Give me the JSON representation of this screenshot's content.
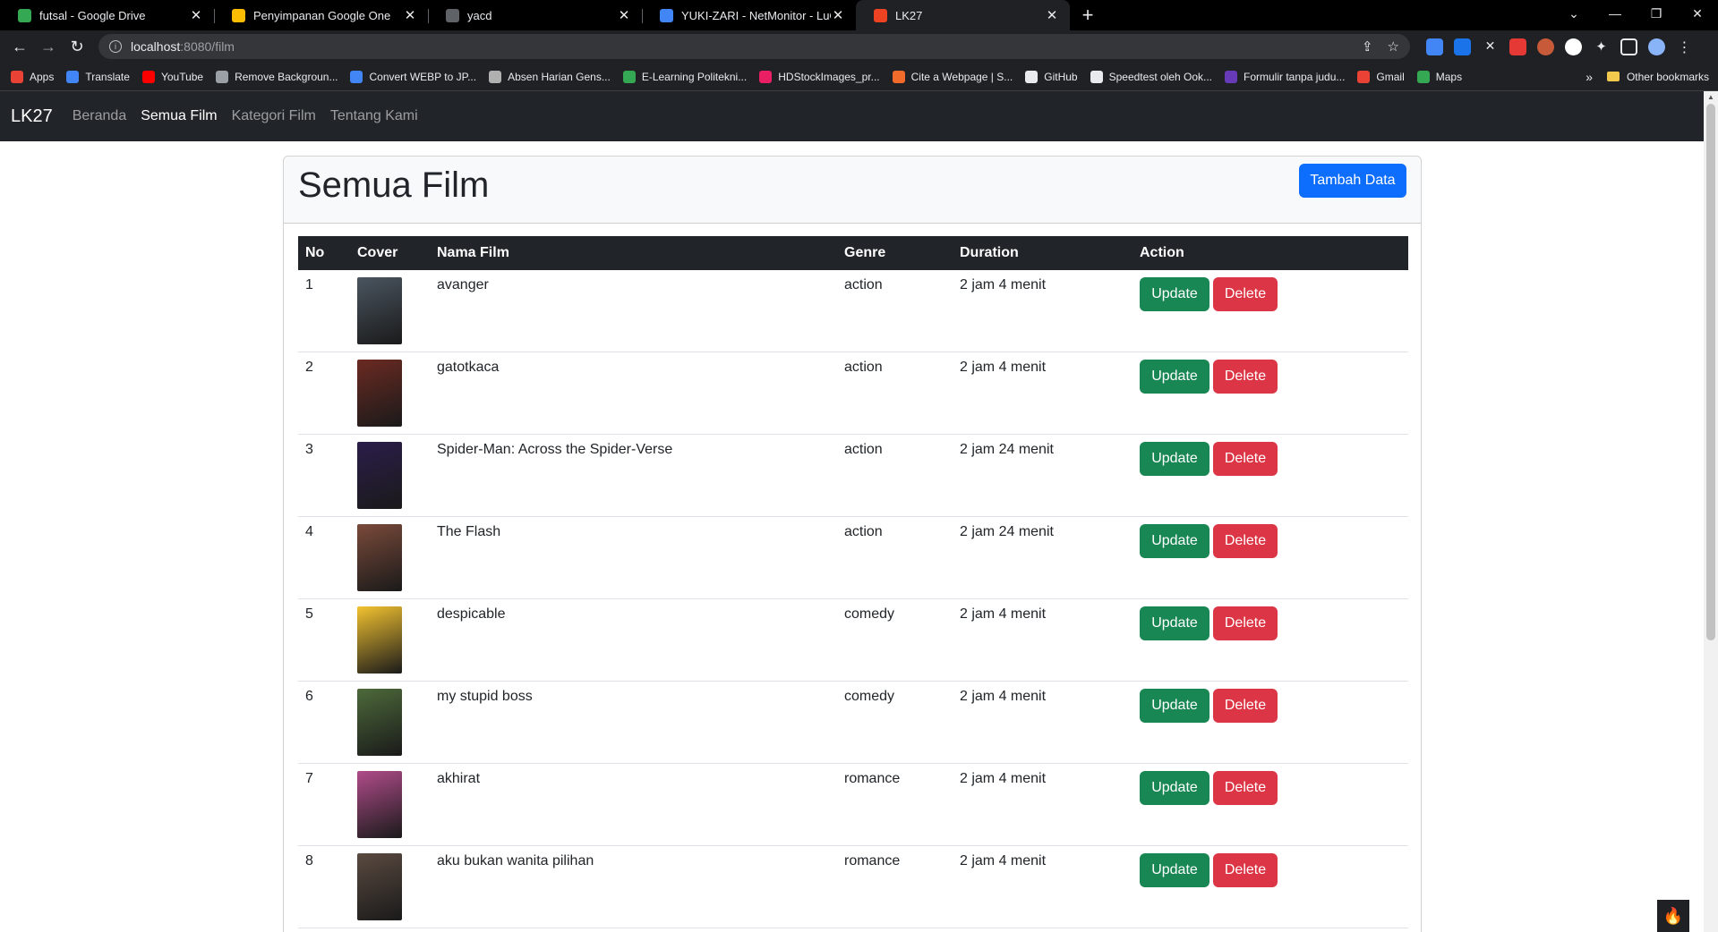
{
  "browser": {
    "tabs": [
      {
        "title": "futsal - Google Drive",
        "icon": "google-drive-icon",
        "color": "#34a853",
        "active": false
      },
      {
        "title": "Penyimpanan Google One",
        "icon": "google-one-icon",
        "color": "#fbbc04",
        "active": false
      },
      {
        "title": "yacd",
        "icon": "yacd-icon",
        "color": "#5f6368",
        "active": false
      },
      {
        "title": "YUKI-ZARI - NetMonitor - LuCI",
        "icon": "luci-icon",
        "color": "#4285f4",
        "active": false
      },
      {
        "title": "LK27",
        "icon": "codeigniter-icon",
        "color": "#ee4323",
        "active": true
      }
    ],
    "url_host": "localhost",
    "url_path": ":8080/film",
    "bookmarks": [
      {
        "label": "Apps",
        "icon": "apps-grid-icon",
        "color": "#ea4335"
      },
      {
        "label": "Translate",
        "icon": "translate-icon",
        "color": "#4285f4"
      },
      {
        "label": "YouTube",
        "icon": "youtube-icon",
        "color": "#ff0000"
      },
      {
        "label": "Remove Backgroun...",
        "icon": "removebg-icon",
        "color": "#9aa0a6"
      },
      {
        "label": "Convert WEBP to JP...",
        "icon": "convert-icon",
        "color": "#4285f4"
      },
      {
        "label": "Absen Harian Gens...",
        "icon": "absen-icon",
        "color": "#b0b0b0"
      },
      {
        "label": "E-Learning Politekni...",
        "icon": "elearning-icon",
        "color": "#34a853"
      },
      {
        "label": "HDStockImages_pr...",
        "icon": "hdstock-icon",
        "color": "#e91e63"
      },
      {
        "label": "Cite a Webpage | S...",
        "icon": "cite-icon",
        "color": "#f26b2b"
      },
      {
        "label": "GitHub",
        "icon": "github-icon",
        "color": "#e8eaed"
      },
      {
        "label": "Speedtest oleh Ook...",
        "icon": "speedtest-icon",
        "color": "#e8eaed"
      },
      {
        "label": "Formulir tanpa judu...",
        "icon": "forms-icon",
        "color": "#673ab7"
      },
      {
        "label": "Gmail",
        "icon": "gmail-icon",
        "color": "#ea4335"
      },
      {
        "label": "Maps",
        "icon": "maps-icon",
        "color": "#34a853"
      }
    ],
    "bookmarks_overflow": "»",
    "other_bookmarks": "Other bookmarks"
  },
  "app": {
    "brand": "LK27",
    "nav": [
      {
        "label": "Beranda",
        "active": false
      },
      {
        "label": "Semua Film",
        "active": true
      },
      {
        "label": "Kategori Film",
        "active": false
      },
      {
        "label": "Tentang Kami",
        "active": false
      }
    ]
  },
  "page": {
    "title": "Semua Film",
    "add_button": "Tambah Data"
  },
  "table": {
    "headers": [
      "No",
      "Cover",
      "Nama Film",
      "Genre",
      "Duration",
      "Action"
    ],
    "update_label": "Update",
    "delete_label": "Delete",
    "rows": [
      {
        "no": "1",
        "name": "avanger",
        "genre": "action",
        "duration": "2 jam 4 menit",
        "cover_color": "#4a5560"
      },
      {
        "no": "2",
        "name": "gatotkaca",
        "genre": "action",
        "duration": "2 jam 4 menit",
        "cover_color": "#6b2a22"
      },
      {
        "no": "3",
        "name": "Spider-Man: Across the Spider-Verse",
        "genre": "action",
        "duration": "2 jam 24 menit",
        "cover_color": "#2b1d4a"
      },
      {
        "no": "4",
        "name": "The Flash",
        "genre": "action",
        "duration": "2 jam 24 menit",
        "cover_color": "#7a4a3a"
      },
      {
        "no": "5",
        "name": "despicable",
        "genre": "comedy",
        "duration": "2 jam 4 menit",
        "cover_color": "#f2c230"
      },
      {
        "no": "6",
        "name": "my stupid boss",
        "genre": "comedy",
        "duration": "2 jam 4 menit",
        "cover_color": "#4d6a3a"
      },
      {
        "no": "7",
        "name": "akhirat",
        "genre": "romance",
        "duration": "2 jam 4 menit",
        "cover_color": "#b04c8a"
      },
      {
        "no": "8",
        "name": "aku bukan wanita pilihan",
        "genre": "romance",
        "duration": "2 jam 4 menit",
        "cover_color": "#5a4a40"
      }
    ]
  }
}
